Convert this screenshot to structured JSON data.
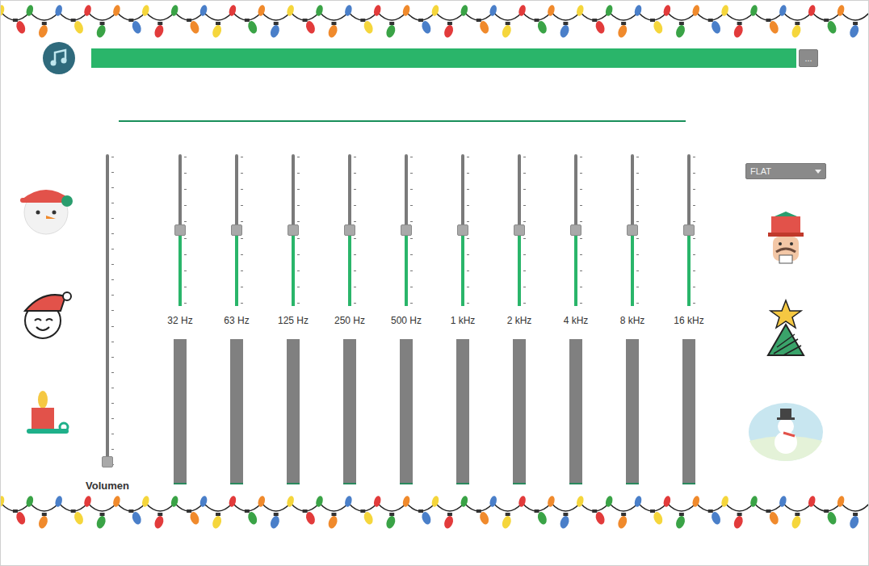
{
  "player": {
    "progress": {
      "level": 1.0
    },
    "browse_button": "..."
  },
  "volume": {
    "label": "Volumen",
    "level": 0
  },
  "bands": [
    {
      "label": "32 Hz",
      "level": 0.5,
      "meter": 0.01
    },
    {
      "label": "63 Hz",
      "level": 0.5,
      "meter": 0.01
    },
    {
      "label": "125 Hz",
      "level": 0.5,
      "meter": 0.01
    },
    {
      "label": "250 Hz",
      "level": 0.5,
      "meter": 0.01
    },
    {
      "label": "500 Hz",
      "level": 0.5,
      "meter": 0.01
    },
    {
      "label": "1 kHz",
      "level": 0.5,
      "meter": 0.01
    },
    {
      "label": "2 kHz",
      "level": 0.5,
      "meter": 0.01
    },
    {
      "label": "4 kHz",
      "level": 0.5,
      "meter": 0.01
    },
    {
      "label": "8 kHz",
      "level": 0.5,
      "meter": 0.01
    },
    {
      "label": "16 kHz",
      "level": 0.5,
      "meter": 0.01
    }
  ],
  "preset": {
    "value": "FLAT"
  }
}
